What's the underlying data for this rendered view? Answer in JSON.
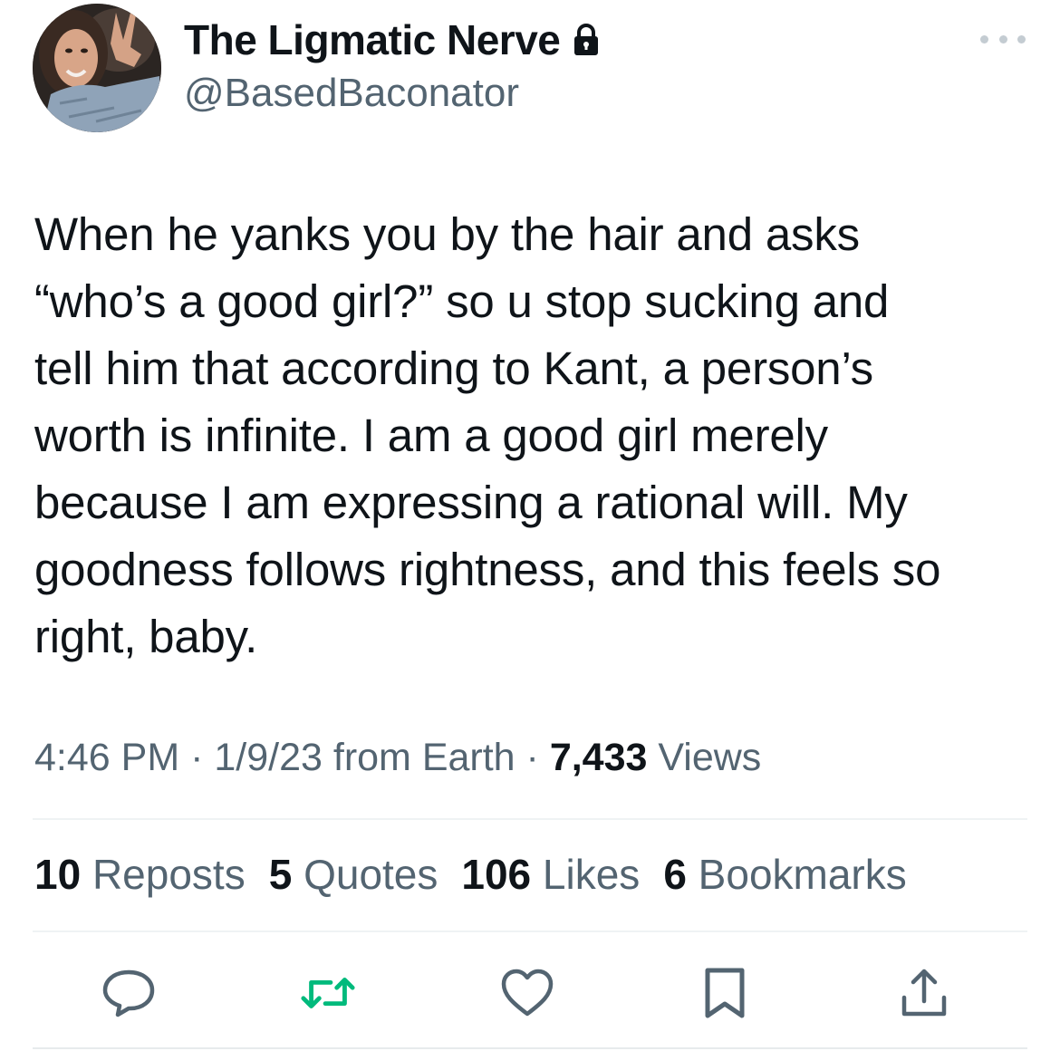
{
  "author": {
    "display_name": "The Ligmatic Nerve",
    "handle": "@BasedBaconator",
    "protected_icon": "lock-icon",
    "avatar": "profile-photo"
  },
  "menu_icon": "more-options-icon",
  "tweet": {
    "text": "When he yanks you by the hair and asks\n“who’s a good girl?” so u stop sucking and\ntell him that according to Kant, a person’s\nworth is infinite. I am a good girl merely\nbecause I am expressing a rational will. My\ngoodness follows rightness, and this feels so\nright, baby."
  },
  "meta": {
    "time": "4:46 PM",
    "sep1": " · ",
    "date": "1/9/23",
    "source": " from Earth",
    "sep2": " · ",
    "views_count": "7,433",
    "views_label": " Views"
  },
  "stats": {
    "reposts_count": "10",
    "reposts_label": " Reposts",
    "quotes_count": "5",
    "quotes_label": " Quotes",
    "likes_count": "106",
    "likes_label": " Likes",
    "bookmarks_count": "6",
    "bookmarks_label": " Bookmarks"
  },
  "actions": {
    "reply_icon": "reply-icon",
    "repost_icon": "repost-icon",
    "like_icon": "heart-icon",
    "bookmark_icon": "bookmark-icon",
    "share_icon": "share-icon"
  },
  "colors": {
    "text_primary": "#0f1419",
    "text_secondary": "#536471",
    "icon_gray": "#536471",
    "repost_green": "#00ba7c",
    "divider": "#eff3f4"
  }
}
